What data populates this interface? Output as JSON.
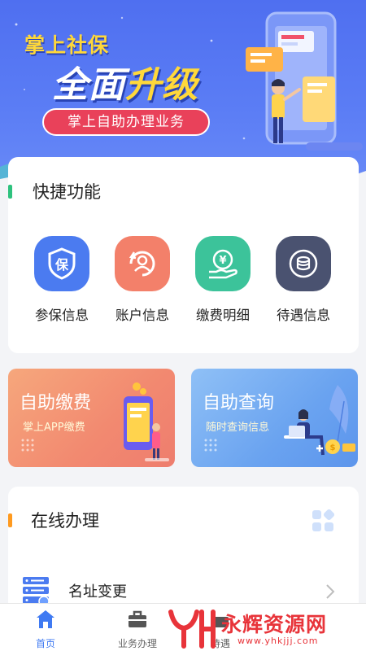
{
  "banner": {
    "line1": "掌上社保",
    "line2_a": "全面",
    "line2_b": "升级",
    "pill": "掌上自助办理业务"
  },
  "quick": {
    "title": "快捷功能",
    "items": [
      {
        "label": "参保信息",
        "icon": "shield-icon",
        "color": "#4b7bf0"
      },
      {
        "label": "账户信息",
        "icon": "person-circle-icon",
        "color": "#f3806a"
      },
      {
        "label": "缴费明细",
        "icon": "yuan-hand-icon",
        "color": "#3cc39a"
      },
      {
        "label": "待遇信息",
        "icon": "coin-stack-icon",
        "color": "#4a5270"
      }
    ]
  },
  "tiles": {
    "left": {
      "title": "自助缴费",
      "subtitle": "掌上APP缴费"
    },
    "right": {
      "title": "自助查询",
      "subtitle": "随时查询信息"
    }
  },
  "online": {
    "title": "在线办理",
    "rows": [
      {
        "label": "名址变更",
        "icon": "server-icon"
      }
    ]
  },
  "nav": {
    "items": [
      {
        "label": "首页",
        "icon": "home-icon",
        "active": true
      },
      {
        "label": "业务办理",
        "icon": "briefcase-icon",
        "active": false
      },
      {
        "label": "待遇",
        "icon": "gift-icon",
        "active": false
      }
    ]
  },
  "watermark": {
    "logo": "YH",
    "text": "永辉资源网",
    "url": "www.yhkjjj.com"
  },
  "colors": {
    "primary": "#3f7af2",
    "banner": "#5674f2",
    "accent_red": "#e9415a",
    "green_bar": "#2ec27e",
    "orange_bar": "#ff9a1f"
  }
}
